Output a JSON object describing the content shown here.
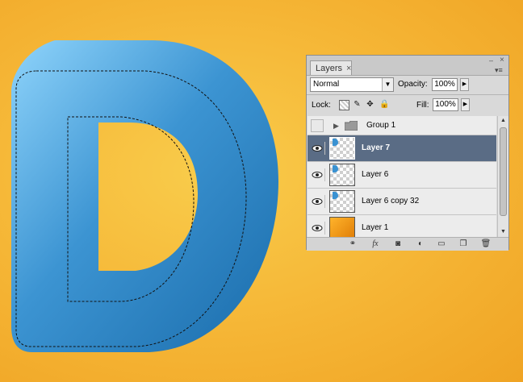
{
  "panel": {
    "tab_label": "Layers",
    "tab_close": "×",
    "minimize": "–",
    "close": "×",
    "menu": "▾≡",
    "blend_mode": "Normal",
    "opacity_label": "Opacity:",
    "opacity_value": "100%",
    "lock_label": "Lock:",
    "fill_label": "Fill:",
    "fill_value": "100%"
  },
  "layers": [
    {
      "name": "Group 1",
      "type": "group",
      "visible": false,
      "selected": false
    },
    {
      "name": "Layer 7",
      "type": "layer",
      "visible": true,
      "selected": true,
      "thumb": "transparent"
    },
    {
      "name": "Layer 6",
      "type": "layer",
      "visible": true,
      "selected": false,
      "thumb": "transparent"
    },
    {
      "name": "Layer 6 copy 32",
      "type": "layer",
      "visible": true,
      "selected": false,
      "thumb": "transparent"
    },
    {
      "name": "Layer 1",
      "type": "layer",
      "visible": true,
      "selected": false,
      "thumb": "orange"
    }
  ],
  "bottom_icons": [
    "link-icon",
    "fx-icon",
    "mask-icon",
    "adjustment-icon",
    "folder-icon",
    "new-layer-icon",
    "trash-icon"
  ],
  "colors": {
    "background": "#f5b535",
    "letter_blue": "#2f86c6",
    "selected_row": "#5a6c85"
  }
}
